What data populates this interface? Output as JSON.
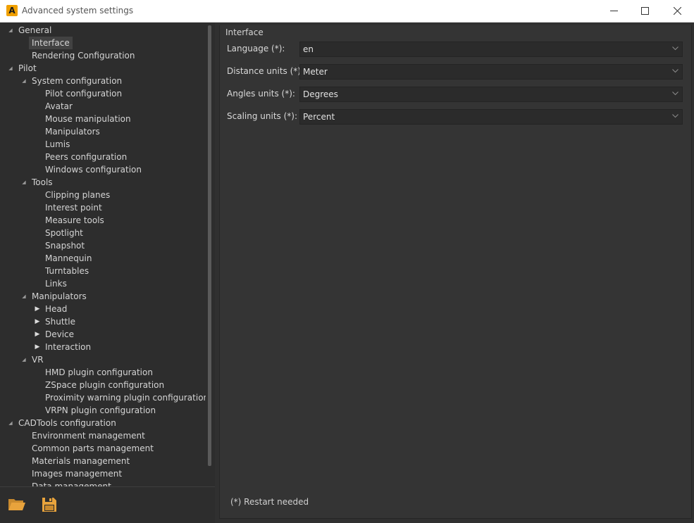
{
  "window": {
    "title": "Advanced system settings",
    "app_icon_letter": "A"
  },
  "tree": {
    "items": [
      {
        "label": "General",
        "level": 0,
        "expander": "expanded"
      },
      {
        "label": "Interface",
        "level": 1,
        "expander": "none",
        "selected": true
      },
      {
        "label": "Rendering Configuration",
        "level": 1,
        "expander": "none"
      },
      {
        "label": "Pilot",
        "level": 0,
        "expander": "expanded"
      },
      {
        "label": "System configuration",
        "level": 1,
        "expander": "expanded"
      },
      {
        "label": "Pilot configuration",
        "level": 2,
        "expander": "none"
      },
      {
        "label": "Avatar",
        "level": 2,
        "expander": "none"
      },
      {
        "label": "Mouse manipulation",
        "level": 2,
        "expander": "none"
      },
      {
        "label": "Manipulators",
        "level": 2,
        "expander": "none"
      },
      {
        "label": "Lumis",
        "level": 2,
        "expander": "none"
      },
      {
        "label": "Peers configuration",
        "level": 2,
        "expander": "none"
      },
      {
        "label": "Windows configuration",
        "level": 2,
        "expander": "none"
      },
      {
        "label": "Tools",
        "level": 1,
        "expander": "expanded"
      },
      {
        "label": "Clipping planes",
        "level": 2,
        "expander": "none"
      },
      {
        "label": "Interest point",
        "level": 2,
        "expander": "none"
      },
      {
        "label": "Measure tools",
        "level": 2,
        "expander": "none"
      },
      {
        "label": "Spotlight",
        "level": 2,
        "expander": "none"
      },
      {
        "label": "Snapshot",
        "level": 2,
        "expander": "none"
      },
      {
        "label": "Mannequin",
        "level": 2,
        "expander": "none"
      },
      {
        "label": "Turntables",
        "level": 2,
        "expander": "none"
      },
      {
        "label": "Links",
        "level": 2,
        "expander": "none"
      },
      {
        "label": "Manipulators",
        "level": 1,
        "expander": "expanded"
      },
      {
        "label": "Head",
        "level": 2,
        "expander": "collapsed"
      },
      {
        "label": "Shuttle",
        "level": 2,
        "expander": "collapsed"
      },
      {
        "label": "Device",
        "level": 2,
        "expander": "collapsed"
      },
      {
        "label": "Interaction",
        "level": 2,
        "expander": "collapsed"
      },
      {
        "label": "VR",
        "level": 1,
        "expander": "expanded"
      },
      {
        "label": "HMD plugin configuration",
        "level": 2,
        "expander": "none"
      },
      {
        "label": "ZSpace plugin configuration",
        "level": 2,
        "expander": "none"
      },
      {
        "label": "Proximity warning plugin configuration",
        "level": 2,
        "expander": "none"
      },
      {
        "label": "VRPN plugin configuration",
        "level": 2,
        "expander": "none"
      },
      {
        "label": "CADTools configuration",
        "level": 0,
        "expander": "expanded"
      },
      {
        "label": "Environment management",
        "level": 1,
        "expander": "none"
      },
      {
        "label": "Common parts management",
        "level": 1,
        "expander": "none"
      },
      {
        "label": "Materials management",
        "level": 1,
        "expander": "none"
      },
      {
        "label": "Images management",
        "level": 1,
        "expander": "none"
      },
      {
        "label": "Data management",
        "level": 1,
        "expander": "none"
      }
    ]
  },
  "toolbar": {
    "open_icon": "folder-open-icon",
    "save_icon": "floppy-disk-icon",
    "accent_color": "#e8a33c"
  },
  "content": {
    "section_title": "Interface",
    "fields": [
      {
        "label": "Language (*):",
        "value": "en"
      },
      {
        "label": "Distance units (*):",
        "value": "Meter"
      },
      {
        "label": "Angles units (*):",
        "value": "Degrees"
      },
      {
        "label": "Scaling units (*):",
        "value": "Percent"
      }
    ],
    "note": "(*) Restart needed"
  }
}
